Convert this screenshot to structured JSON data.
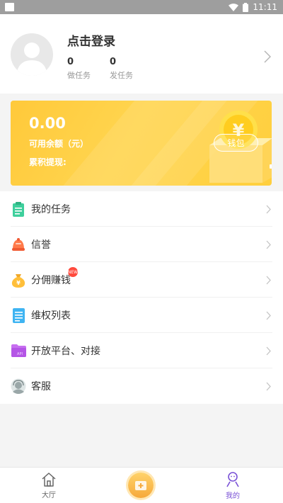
{
  "status_bar": {
    "time": "11:11"
  },
  "profile": {
    "login_text": "点击登录",
    "stats": [
      {
        "value": "0",
        "label": "做任务"
      },
      {
        "value": "0",
        "label": "发任务"
      }
    ]
  },
  "wallet": {
    "balance": "0.00",
    "balance_label": "可用余额（元）",
    "withdraw_label": "累积提现:",
    "button_label": "钱包"
  },
  "menu": [
    {
      "label": "我的任务",
      "icon": "clipboard-icon",
      "color": "#3ecf9c"
    },
    {
      "label": "信誉",
      "icon": "bell-icon",
      "color": "#ff7a4a"
    },
    {
      "label": "分佣赚钱",
      "icon": "money-bag-icon",
      "color": "#ffbf3a",
      "badge": "NEW"
    },
    {
      "label": "维权列表",
      "icon": "document-icon",
      "color": "#3fb4f2"
    },
    {
      "label": "开放平台、对接",
      "icon": "api-folder-icon",
      "color": "#c76ff0"
    },
    {
      "label": "客服",
      "icon": "customer-service-icon",
      "color": "#9aa7a8"
    }
  ],
  "tabs": [
    {
      "label": "大厅",
      "icon": "home-icon"
    },
    {
      "label": "",
      "icon": "add-icon"
    },
    {
      "label": "我的",
      "icon": "person-icon"
    }
  ],
  "colors": {
    "accent": "#7a52d6",
    "card": "#ffc93a",
    "tab_inactive": "#666666"
  }
}
